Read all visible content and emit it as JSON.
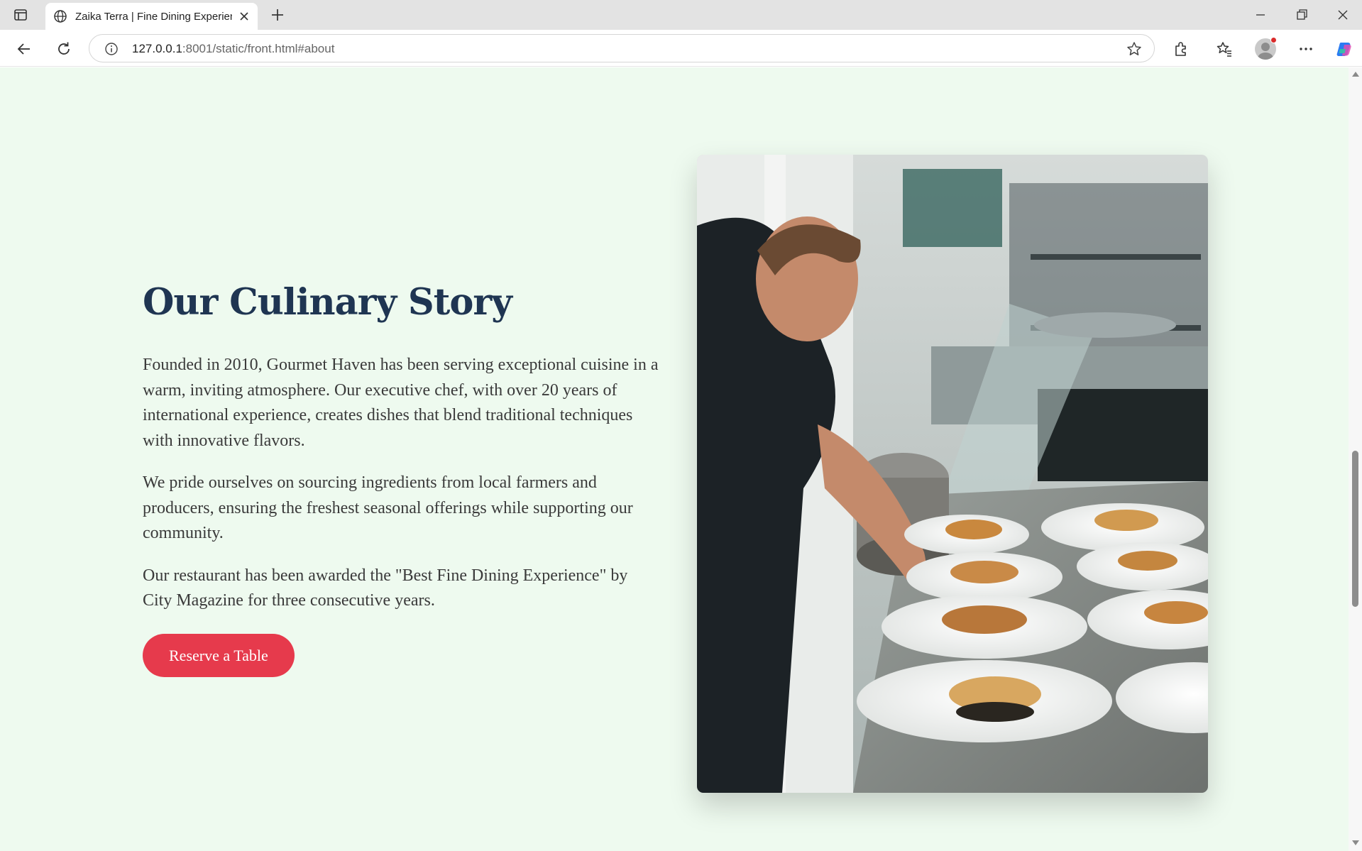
{
  "browser": {
    "tab_title": "Zaika Terra | Fine Dining Experience",
    "url_host": "127.0.0.1",
    "url_rest": ":8001/static/front.html#about"
  },
  "about": {
    "title": "Our Culinary Story",
    "paragraphs": [
      "Founded in 2010, Gourmet Haven has been serving exceptional cuisine in a warm, inviting atmosphere. Our executive chef, with over 20 years of international experience, creates dishes that blend traditional techniques with innovative flavors.",
      "We pride ourselves on sourcing ingredients from local farmers and producers, ensuring the freshest seasonal offerings while supporting our community.",
      "Our restaurant has been awarded the \"Best Fine Dining Experience\" by City Magazine for three consecutive years."
    ],
    "cta_label": "Reserve a Table",
    "image_subject": "chef plating fish dishes in a restaurant kitchen"
  },
  "colors": {
    "page_background": "#eefaef",
    "heading": "#1f3552",
    "body_text": "#3a3a3a",
    "accent": "#e63a4c"
  }
}
